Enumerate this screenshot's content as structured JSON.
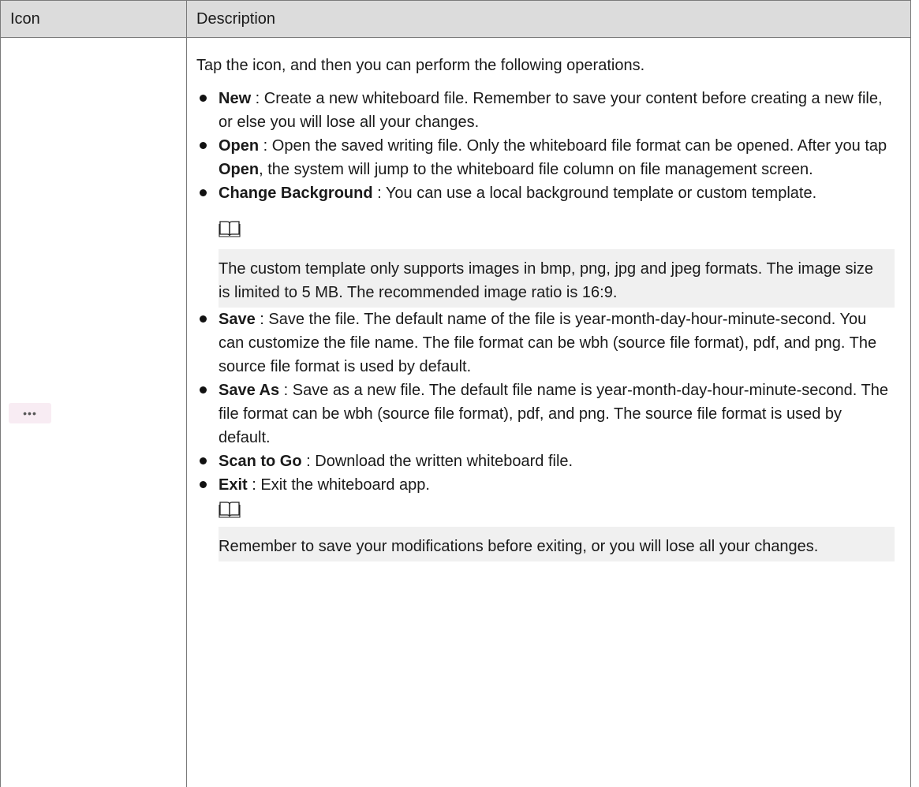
{
  "table": {
    "header": {
      "icon": "Icon",
      "description": "Description"
    },
    "icon_name": "more-options-icon",
    "icon_glyph": "•••",
    "intro": "Tap the icon, and then you can perform the following operations.",
    "items": [
      {
        "name": "New",
        "text": " : Create a new whiteboard file. Remember to save your content before creating a new file, or else you will lose all your changes."
      },
      {
        "name": "Open",
        "text_before": " : Open the saved writing file. Only the whiteboard file format can be opened. After you tap ",
        "inline_bold": "Open",
        "text_after": ", the system will jump to the whiteboard file column on file management screen."
      },
      {
        "name": "Change Background",
        "text": " : You can use a local background template or custom template."
      },
      {
        "name": "Save",
        "text": " : Save the file. The default name of the file is year-month-day-hour-minute-second. You can customize the file name. The file format can be wbh (source file format), pdf, and png. The source file format is used by default."
      },
      {
        "name": "Save As",
        "text": " : Save as a new file. The default file name is year-month-day-hour-minute-second. The file format can be wbh (source file format), pdf, and png. The source file format is used by default."
      },
      {
        "name": "Scan to Go",
        "text": " : Download the written whiteboard file."
      },
      {
        "name": "Exit",
        "text": " : Exit the whiteboard app."
      }
    ],
    "notes": {
      "background": "The custom template only supports images in bmp, png, jpg and jpeg formats. The image size is limited to 5 MB. The recommended image ratio is 16:9.",
      "exit": "Remember to save your modifications before exiting, or you will lose all your changes."
    },
    "note_icon_name": "note-book-icon"
  }
}
